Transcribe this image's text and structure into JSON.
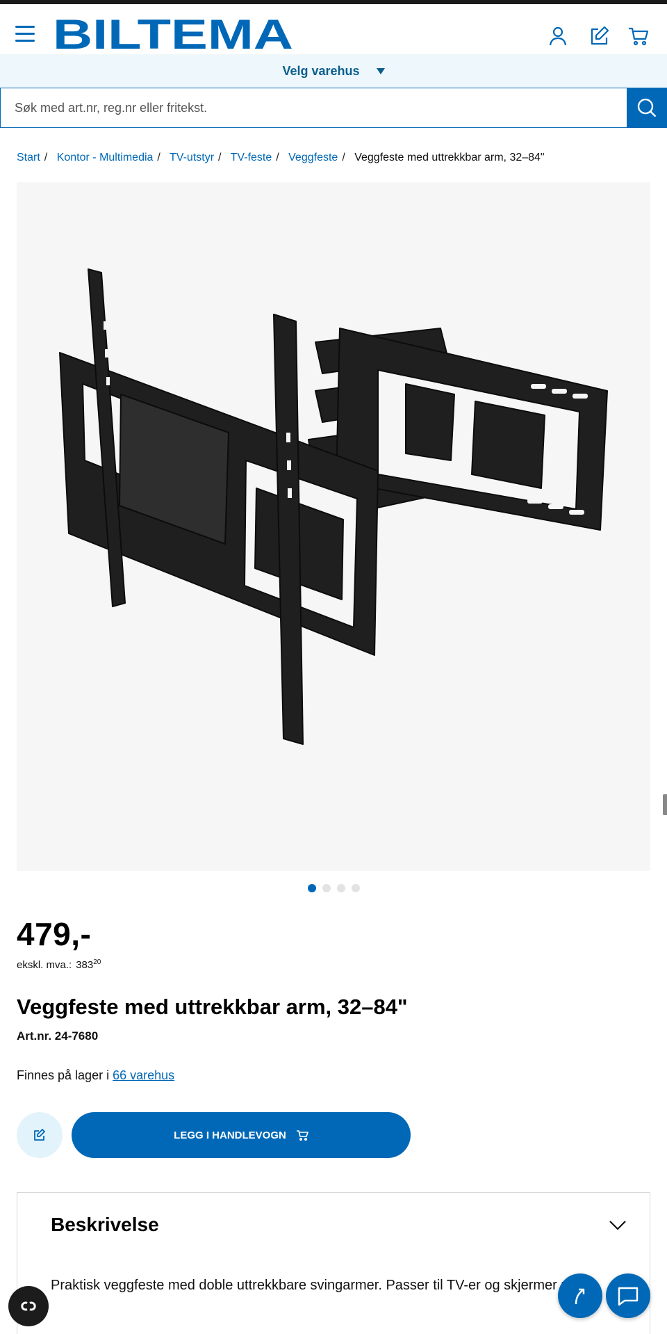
{
  "colors": {
    "brand": "#0068b7",
    "store_bar_bg": "#eef7fc",
    "gallery_bg": "#f6f6f6",
    "dark_strip": "#1a1a1a"
  },
  "header": {
    "logo_text": "BILTEMA",
    "icons": [
      "menu-icon",
      "user-icon",
      "edit-note-icon",
      "cart-icon"
    ]
  },
  "store_selector": {
    "label": "Velg varehus"
  },
  "search": {
    "placeholder": "Søk med art.nr, reg.nr eller fritekst."
  },
  "breadcrumb": [
    {
      "label": "Start"
    },
    {
      "label": "Kontor - Multimedia"
    },
    {
      "label": "TV-utstyr"
    },
    {
      "label": "TV-feste"
    },
    {
      "label": "Veggfeste"
    }
  ],
  "breadcrumb_current": "Veggfeste med uttrekkbar arm, 32–84\"",
  "gallery": {
    "image_count": 4,
    "active_index": 0
  },
  "product": {
    "price": "479,-",
    "exvat_label": "ekskl. mva.:",
    "exvat_whole": "383",
    "exvat_cents": "20",
    "title": "Veggfeste med uttrekkbar arm, 32–84\"",
    "art_nr": "Art.nr. 24-7680",
    "stock_prefix": "Finnes på lager i",
    "stock_link": "66 varehus",
    "add_to_cart": "LEGG I HANDLEVOGN"
  },
  "description": {
    "heading": "Beskrivelse",
    "text": "Praktisk veggfeste med doble uttrekkbare svingarmer. Passer til TV-er og skjermer r 84\"."
  }
}
